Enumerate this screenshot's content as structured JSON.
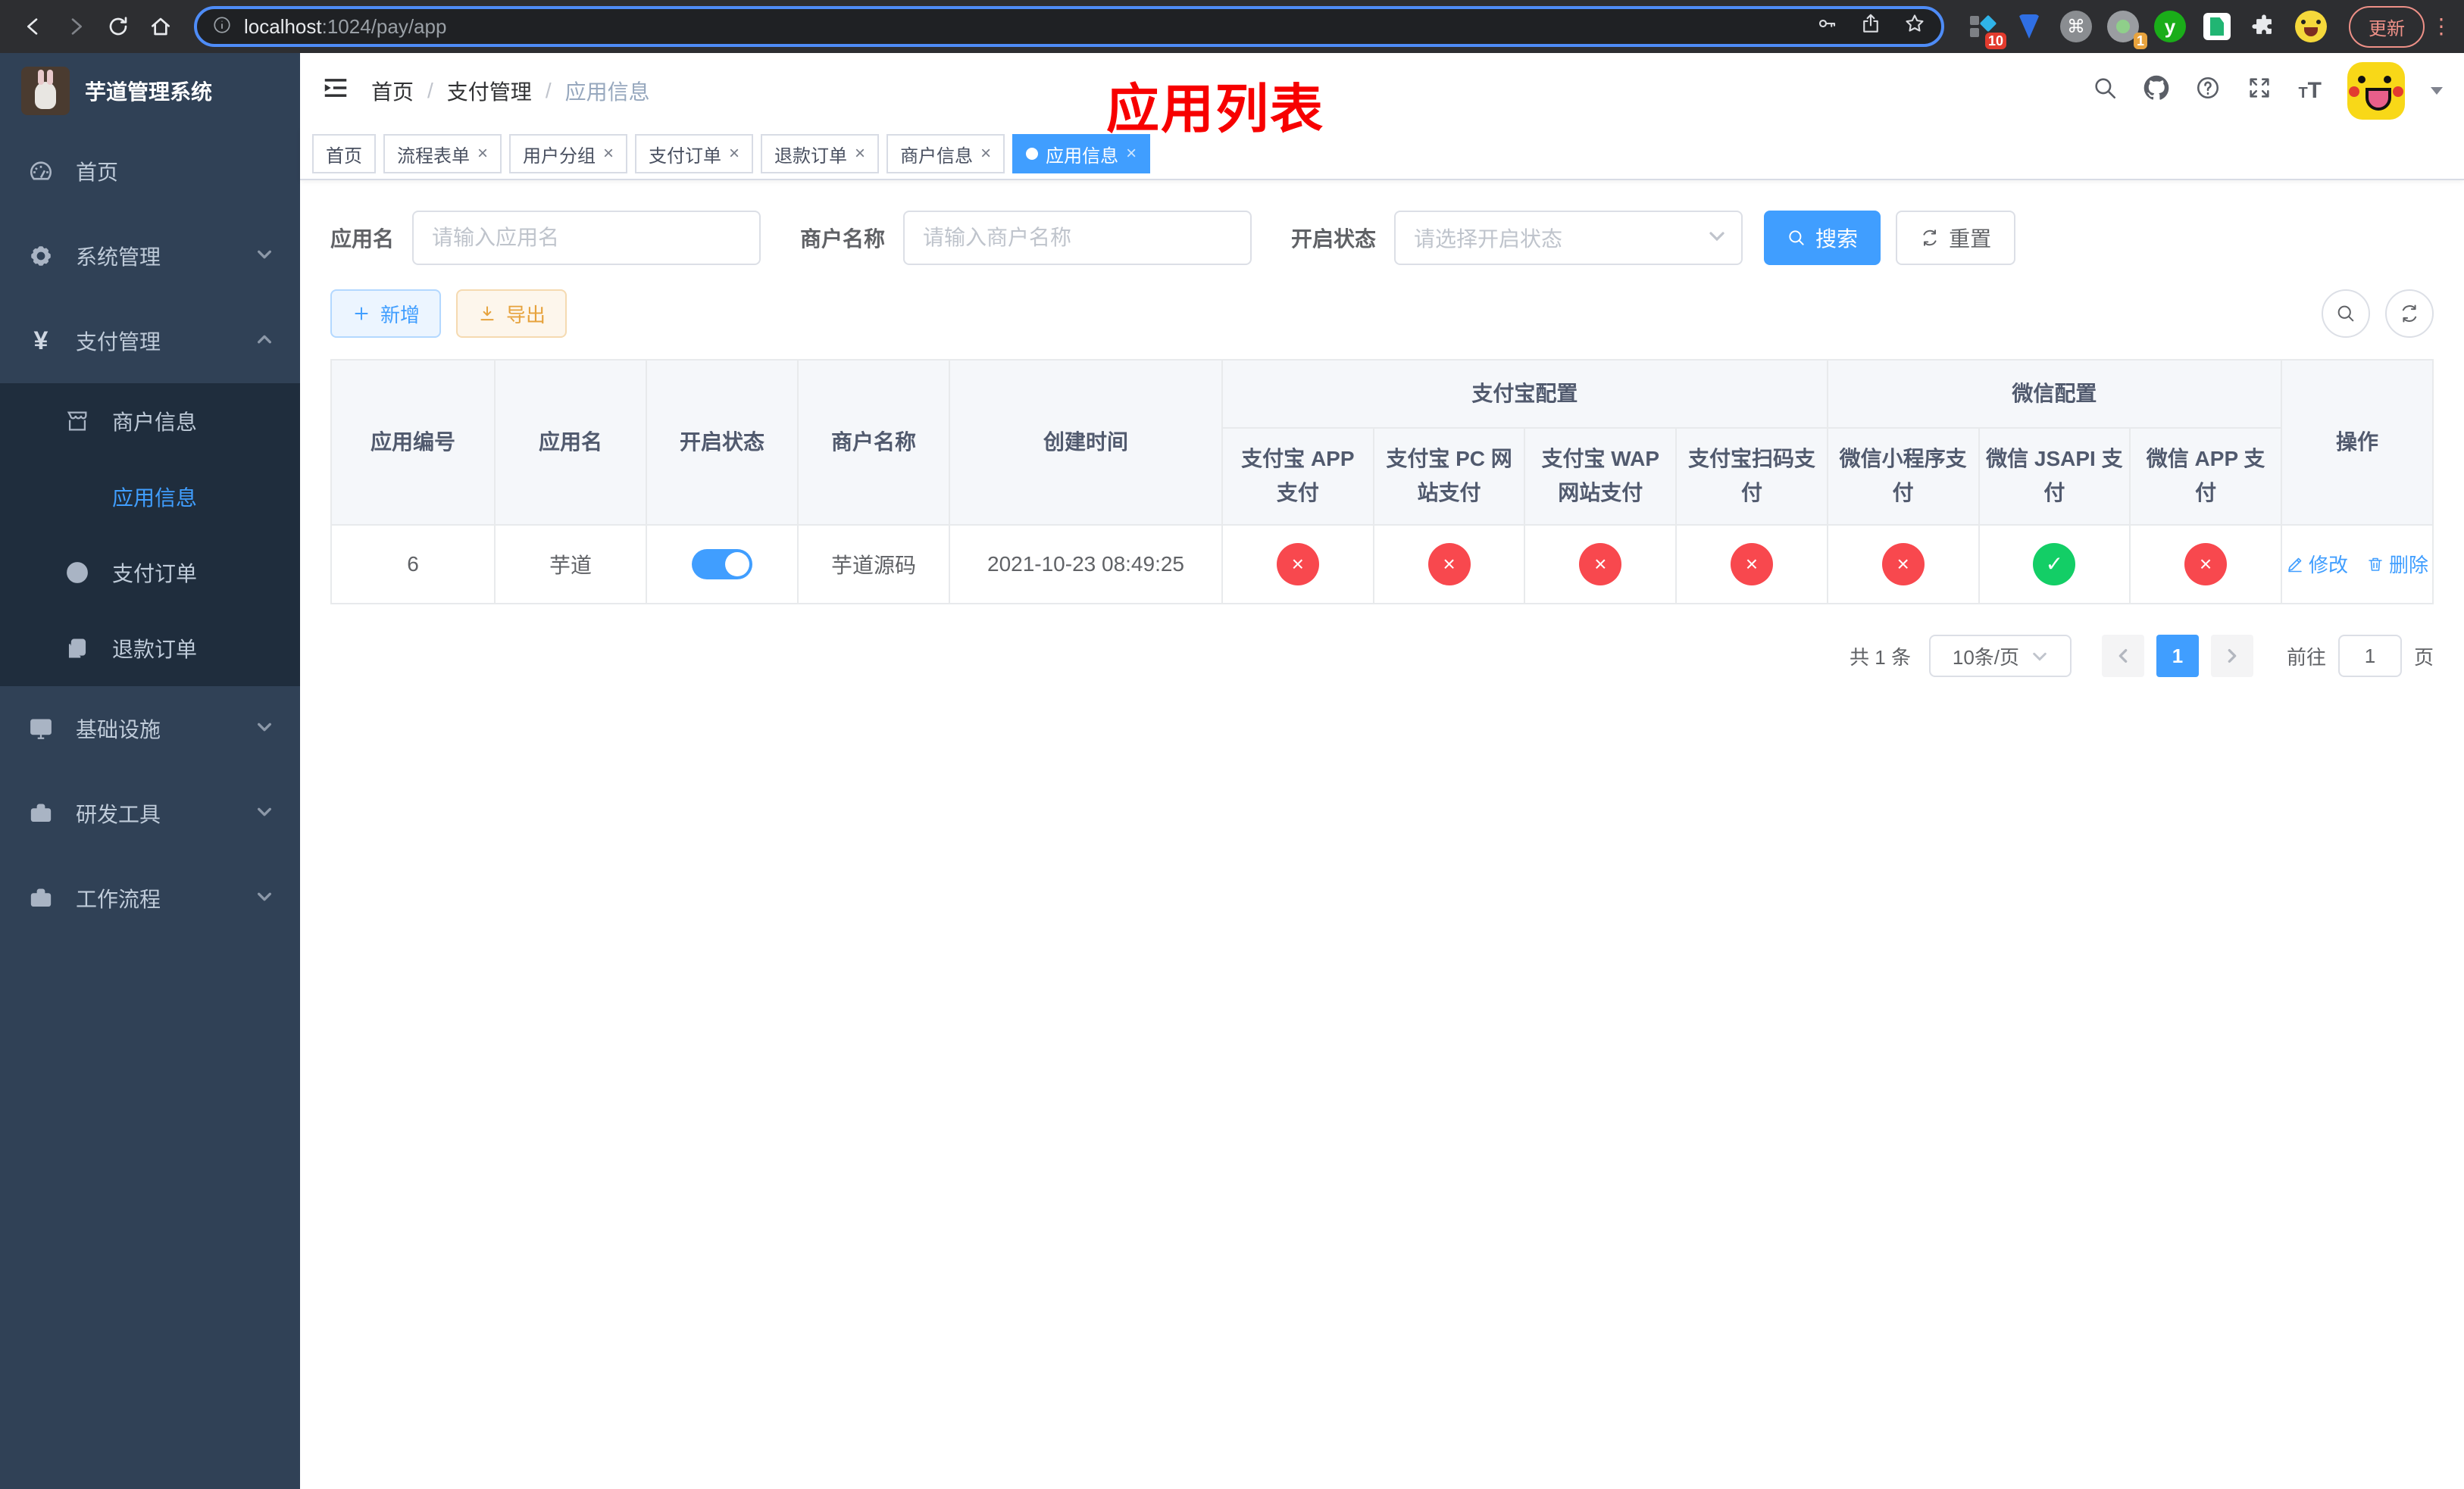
{
  "browser": {
    "url_host": "localhost",
    "url_rest": ":1024/pay/app",
    "update_button": "更新",
    "ext_badge_blocks": "10",
    "ext_badge_cam": "1",
    "ext_letter": "y"
  },
  "sidebar": {
    "title": "芋道管理系统",
    "items": [
      {
        "label": "首页",
        "icon": "dashboard-icon"
      },
      {
        "label": "系统管理",
        "icon": "gear-icon"
      },
      {
        "label": "支付管理",
        "icon": "yen-icon"
      },
      {
        "label": "基础设施",
        "icon": "monitor-icon"
      },
      {
        "label": "研发工具",
        "icon": "toolbox-icon"
      },
      {
        "label": "工作流程",
        "icon": "briefcase-icon"
      }
    ],
    "submenu": [
      {
        "label": "商户信息",
        "icon": "shop-icon"
      },
      {
        "label": "应用信息",
        "icon": "grid-icon",
        "active": true
      },
      {
        "label": "支付订单",
        "icon": "yen-circle-icon"
      },
      {
        "label": "退款订单",
        "icon": "document-icon"
      }
    ]
  },
  "navbar": {
    "breadcrumb": [
      "首页",
      "支付管理",
      "应用信息"
    ]
  },
  "annotation": {
    "text": "应用列表",
    "color": "#f70000"
  },
  "tabs": [
    {
      "label": "首页",
      "closable": false
    },
    {
      "label": "流程表单",
      "closable": true
    },
    {
      "label": "用户分组",
      "closable": true
    },
    {
      "label": "支付订单",
      "closable": true
    },
    {
      "label": "退款订单",
      "closable": true
    },
    {
      "label": "商户信息",
      "closable": true
    },
    {
      "label": "应用信息",
      "closable": true,
      "active": true
    }
  ],
  "filters": {
    "app_name_label": "应用名",
    "app_name_placeholder": "请输入应用名",
    "merchant_label": "商户名称",
    "merchant_placeholder": "请输入商户名称",
    "status_label": "开启状态",
    "status_placeholder": "请选择开启状态",
    "search_button": "搜索",
    "reset_button": "重置"
  },
  "toolbar": {
    "add_button": "新增",
    "export_button": "导出"
  },
  "table": {
    "columns": [
      "应用编号",
      "应用名",
      "开启状态",
      "商户名称",
      "创建时间"
    ],
    "groups": [
      {
        "label": "支付宝配置",
        "children": [
          "支付宝 APP 支付",
          "支付宝 PC 网站支付",
          "支付宝 WAP 网站支付",
          "支付宝扫码支付"
        ]
      },
      {
        "label": "微信配置",
        "children": [
          "微信小程序支付",
          "微信 JSAPI 支付",
          "微信 APP 支付"
        ]
      }
    ],
    "op_column": "操作",
    "row": {
      "id": "6",
      "name": "芋道",
      "enabled": true,
      "merchant": "芋道源码",
      "created_at": "2021-10-23 08:49:25",
      "pay_statuses": [
        false,
        false,
        false,
        false,
        false,
        true,
        false
      ],
      "edit_action": "修改",
      "delete_action": "删除"
    }
  },
  "pagination": {
    "total": "共 1 条",
    "page_size": "10条/页",
    "current_page": "1",
    "goto_label": "前往",
    "goto_value": "1",
    "page_unit": "页"
  },
  "colors": {
    "primary": "#409eff",
    "success": "#13ce66",
    "danger": "#f8484e",
    "warning": "#e6a23c"
  }
}
